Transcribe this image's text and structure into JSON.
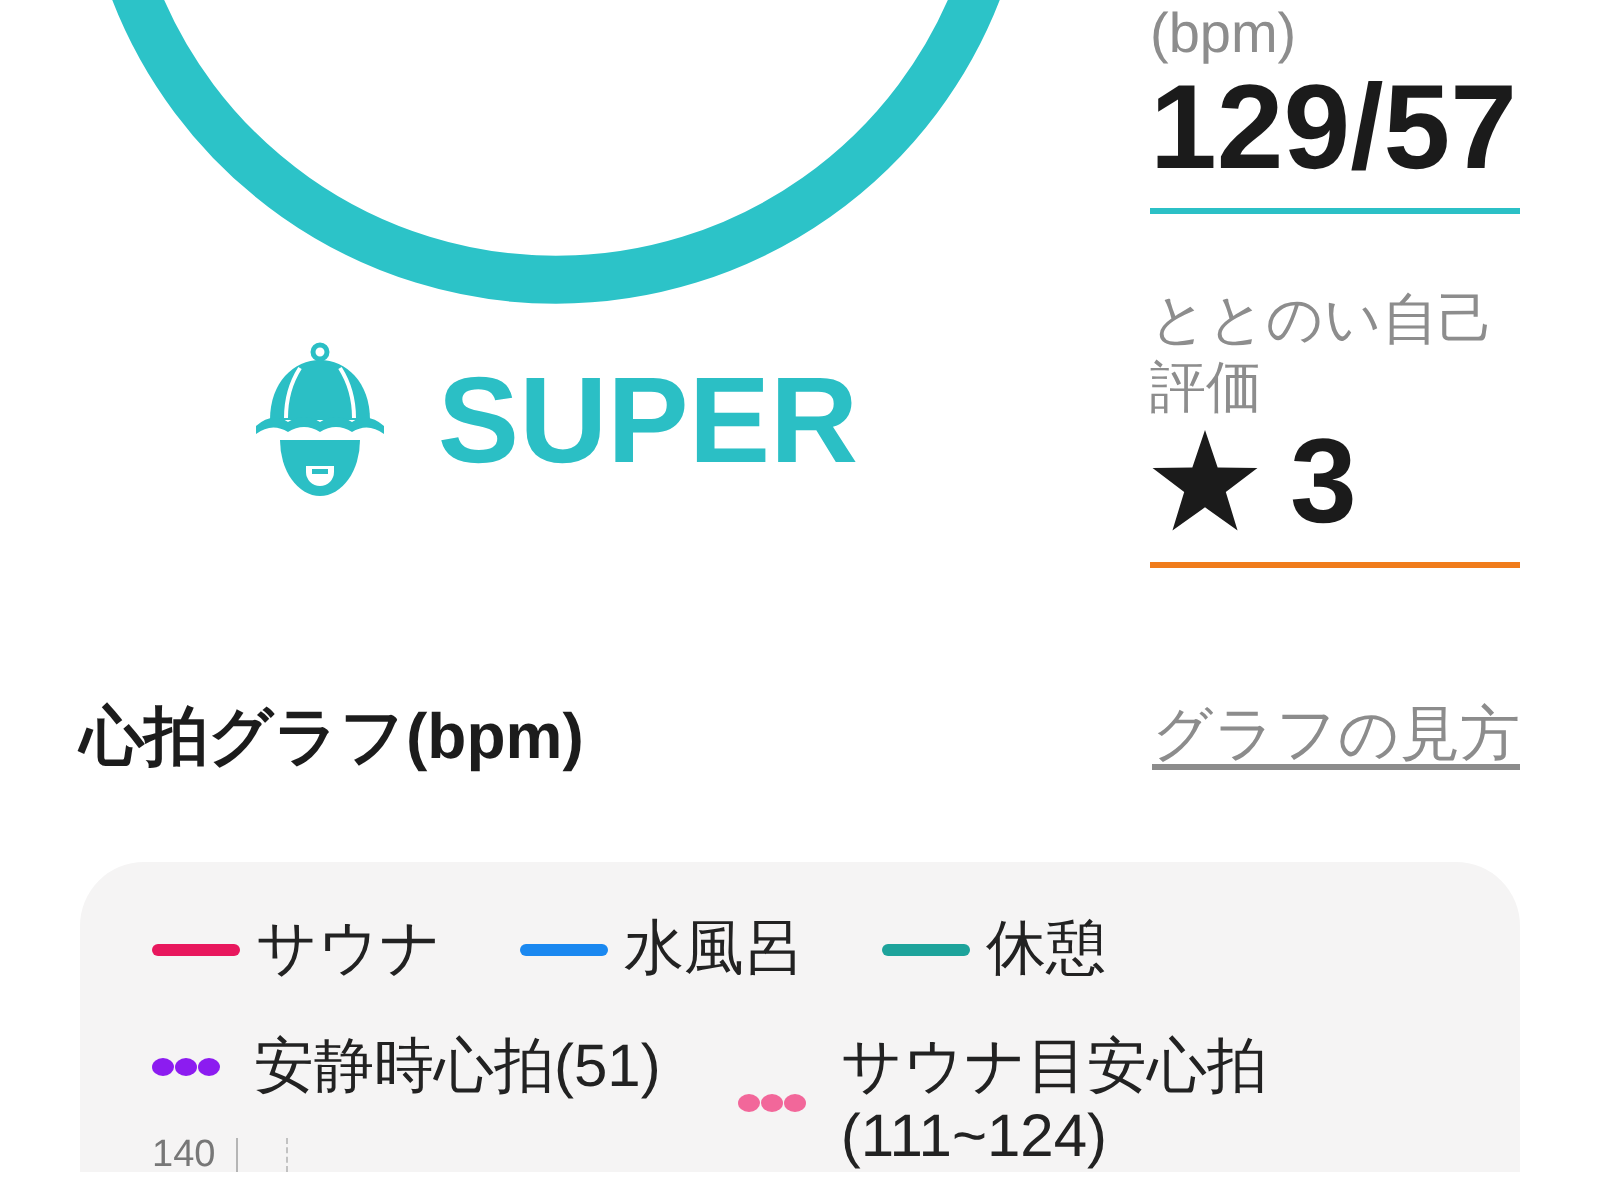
{
  "rank": {
    "title": "SUPER"
  },
  "stats": [
    {
      "kind": "number",
      "label": "(bpm)",
      "value": "129/57",
      "color": "#2bc0c6"
    },
    {
      "kind": "rating",
      "label": "ととのい自己評価",
      "value": "3",
      "color": "#f07c1c"
    }
  ],
  "graph": {
    "title": "心拍グラフ(bpm)",
    "help_link": "グラフの見方",
    "legend": [
      {
        "kind": "line",
        "label": "サウナ",
        "color": "#e8175d"
      },
      {
        "kind": "line",
        "label": "水風呂",
        "color": "#1a88f0"
      },
      {
        "kind": "line",
        "label": "休憩",
        "color": "#1da39b"
      },
      {
        "kind": "dots",
        "label": "安静時心拍(51)",
        "color": "#8c1cf0"
      },
      {
        "kind": "dots",
        "label": "サウナ目安心拍(111~124)",
        "color": "#f2679a"
      }
    ],
    "chart": {
      "tick_labels": [
        "140"
      ]
    }
  }
}
